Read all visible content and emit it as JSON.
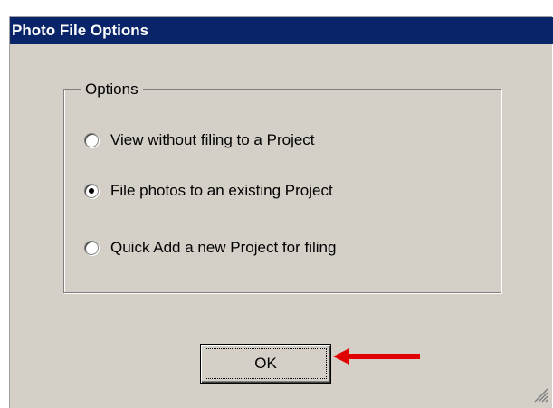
{
  "dialog": {
    "title": "Photo File Options",
    "group_label": "Options",
    "options": [
      {
        "label": "View without filing to a Project",
        "selected": false
      },
      {
        "label": "File photos to an existing Project",
        "selected": true
      },
      {
        "label": "Quick Add a new Project for filing",
        "selected": false
      }
    ],
    "ok_label": "OK"
  },
  "annotation": {
    "arrow_color": "#e00000",
    "arrow_icon": "arrow-left-icon"
  },
  "colors": {
    "titlebar": "#0a246a",
    "window": "#d4d0c8"
  }
}
